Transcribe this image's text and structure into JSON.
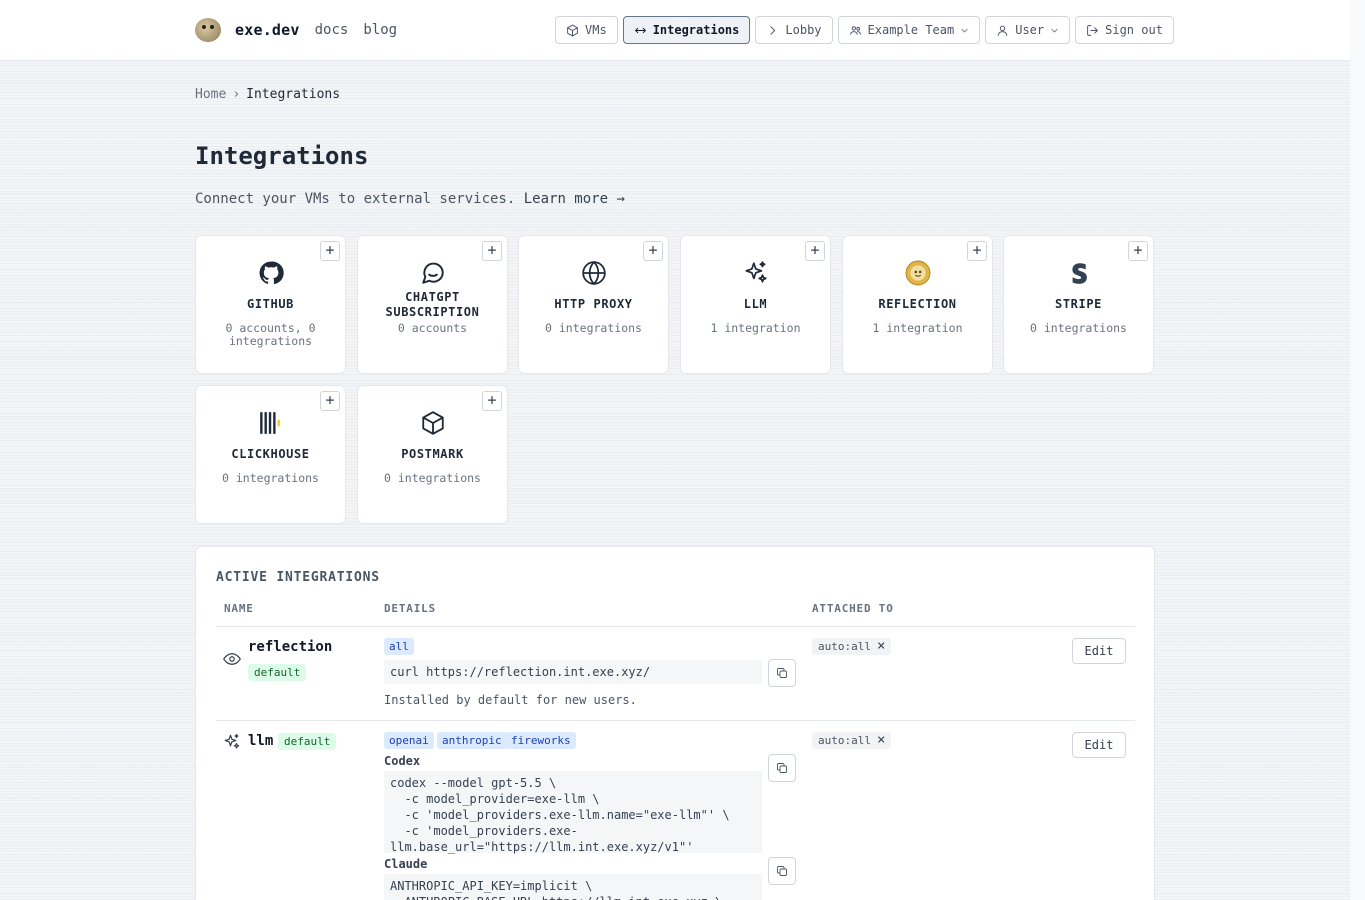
{
  "header": {
    "brand": "exe.dev",
    "links": [
      "docs",
      "blog"
    ],
    "nav": {
      "vms": "VMs",
      "integrations": "Integrations",
      "lobby": "Lobby",
      "team": "Example Team",
      "user": "User",
      "signout": "Sign out"
    }
  },
  "breadcrumb": {
    "home": "Home",
    "sep": "›",
    "current": "Integrations"
  },
  "page": {
    "title": "Integrations",
    "subtitle": "Connect your VMs to external services.",
    "learn_more": "Learn more →"
  },
  "cards": [
    {
      "title": "GITHUB",
      "count": "0 accounts, 0 integrations",
      "icon": "github-icon"
    },
    {
      "title": "CHATGPT SUBSCRIPTION",
      "count": "0 accounts",
      "icon": "chat-icon"
    },
    {
      "title": "HTTP PROXY",
      "count": "0 integrations",
      "icon": "globe-icon"
    },
    {
      "title": "LLM",
      "count": "1 integration",
      "icon": "sparkles-icon"
    },
    {
      "title": "REFLECTION",
      "count": "1 integration",
      "icon": "reflection-logo-icon"
    },
    {
      "title": "STRIPE",
      "count": "0 integrations",
      "icon": "stripe-icon"
    },
    {
      "title": "CLICKHOUSE",
      "count": "0 integrations",
      "icon": "clickhouse-icon"
    },
    {
      "title": "POSTMARK",
      "count": "0 integrations",
      "icon": "box-icon"
    }
  ],
  "add_label": "+",
  "active": {
    "title": "ACTIVE INTEGRATIONS",
    "columns": {
      "name": "NAME",
      "details": "DETAILS",
      "attached": "ATTACHED TO"
    },
    "rows": [
      {
        "name": "reflection",
        "badge": "default",
        "tags": [
          "all"
        ],
        "code": "curl https://reflection.int.exe.xyz/",
        "note": "Installed by default for new users.",
        "attached": "auto:all",
        "edit": "Edit"
      },
      {
        "name": "llm",
        "badge": "default",
        "tags": [
          "openai",
          "anthropic",
          "fireworks"
        ],
        "codex_label": "Codex",
        "codex_code": "codex --model gpt-5.5 \\\n  -c model_provider=exe-llm \\\n  -c 'model_providers.exe-llm.name=\"exe-llm\"' \\\n  -c 'model_providers.exe-\nllm.base_url=\"https://llm.int.exe.xyz/v1\"'",
        "claude_label": "Claude",
        "claude_code": "ANTHROPIC_API_KEY=implicit \\\n  ANTHROPIC_BASE_URL=https://llm.int.exe.xyz \\",
        "attached": "auto:all",
        "edit": "Edit"
      }
    ],
    "remove_symbol": "×"
  },
  "colors": {
    "accent": "#1e40af",
    "default_badge": "#dcfce7",
    "tag": "#dbeafe"
  }
}
